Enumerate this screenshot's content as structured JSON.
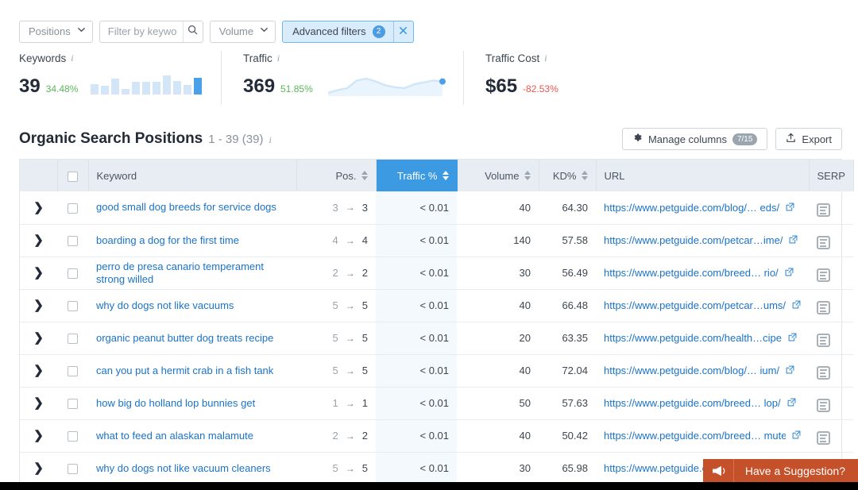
{
  "filters": {
    "positions_label": "Positions",
    "keyword_placeholder": "Filter by keyword",
    "keyword_value": "",
    "volume_label": "Volume",
    "advanced_label": "Advanced filters",
    "advanced_count": "2",
    "close_icon": "close-icon",
    "search_icon": "search-icon"
  },
  "metrics": {
    "keywords": {
      "label": "Keywords",
      "value": "39",
      "delta": "34.48%",
      "delta_dir": "up",
      "bars": [
        10,
        8,
        15,
        5,
        12,
        12,
        12,
        18,
        13,
        9,
        16
      ]
    },
    "traffic": {
      "label": "Traffic",
      "value": "369",
      "delta": "51.85%",
      "delta_dir": "up",
      "points": [
        4,
        7,
        9,
        17,
        19,
        16,
        12,
        10,
        9,
        13,
        15,
        17,
        16
      ]
    },
    "traffic_cost": {
      "label": "Traffic Cost",
      "value": "$65",
      "delta": "-82.53%",
      "delta_dir": "down"
    }
  },
  "section": {
    "title": "Organic Search Positions",
    "count": "1 - 39 (39)",
    "manage_columns_label": "Manage columns",
    "manage_columns_badge": "7/15",
    "export_label": "Export"
  },
  "table": {
    "columns": {
      "keyword": "Keyword",
      "pos": "Pos.",
      "traffic": "Traffic %",
      "volume": "Volume",
      "kd": "KD%",
      "url": "URL",
      "serp": "SERP"
    },
    "rows": [
      {
        "keyword": "good small dog breeds for service dogs",
        "pos_from": "3",
        "pos_to": "3",
        "traffic": "< 0.01",
        "volume": "40",
        "kd": "64.30",
        "url": "https://www.petguide.com/blog/… eds/"
      },
      {
        "keyword": "boarding a dog for the first time",
        "pos_from": "4",
        "pos_to": "4",
        "traffic": "< 0.01",
        "volume": "140",
        "kd": "57.58",
        "url": "https://www.petguide.com/petcar…ime/"
      },
      {
        "keyword": "perro de presa canario temperament strong willed",
        "pos_from": "2",
        "pos_to": "2",
        "traffic": "< 0.01",
        "volume": "30",
        "kd": "56.49",
        "url": "https://www.petguide.com/breed… rio/"
      },
      {
        "keyword": "why do dogs not like vacuums",
        "pos_from": "5",
        "pos_to": "5",
        "traffic": "< 0.01",
        "volume": "40",
        "kd": "66.48",
        "url": "https://www.petguide.com/petcar…ums/"
      },
      {
        "keyword": "organic peanut butter dog treats recipe",
        "pos_from": "5",
        "pos_to": "5",
        "traffic": "< 0.01",
        "volume": "20",
        "kd": "63.35",
        "url": "https://www.petguide.com/health…cipe"
      },
      {
        "keyword": "can you put a hermit crab in a fish tank",
        "pos_from": "5",
        "pos_to": "5",
        "traffic": "< 0.01",
        "volume": "40",
        "kd": "72.04",
        "url": "https://www.petguide.com/blog/… ium/"
      },
      {
        "keyword": "how big do holland lop bunnies get",
        "pos_from": "1",
        "pos_to": "1",
        "traffic": "< 0.01",
        "volume": "50",
        "kd": "57.63",
        "url": "https://www.petguide.com/breed… lop/"
      },
      {
        "keyword": "what to feed an alaskan malamute",
        "pos_from": "2",
        "pos_to": "2",
        "traffic": "< 0.01",
        "volume": "40",
        "kd": "50.42",
        "url": "https://www.petguide.com/breed… mute"
      },
      {
        "keyword": "why do dogs not like vacuum cleaners",
        "pos_from": "5",
        "pos_to": "5",
        "traffic": "< 0.01",
        "volume": "30",
        "kd": "65.98",
        "url": "https://www.petguide.com/petcare…"
      }
    ]
  },
  "suggestion": {
    "label": "Have a Suggestion?",
    "icon": "megaphone-icon"
  }
}
